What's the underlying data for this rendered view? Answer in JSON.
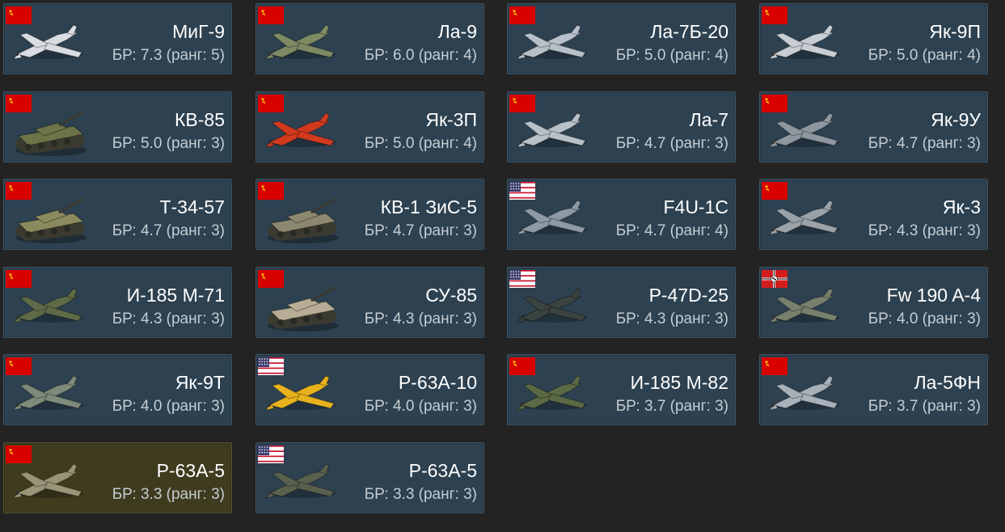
{
  "colors": {
    "background": "#232323",
    "card": "#2d4150",
    "card_premium": "#3f3b1f",
    "name_text": "#ffffff",
    "br_text": "#c5cdd3"
  },
  "vehicles": [
    {
      "name": "МиГ-9",
      "br": "БР: 7.3 (ранг: 5)",
      "nation": "ussr",
      "type": "plane",
      "color": "#d9dde2",
      "premium": false
    },
    {
      "name": "Ла-9",
      "br": "БР: 6.0 (ранг: 4)",
      "nation": "ussr",
      "type": "plane",
      "color": "#7d8a63",
      "premium": false
    },
    {
      "name": "Ла-7Б-20",
      "br": "БР: 5.0 (ранг: 4)",
      "nation": "ussr",
      "type": "plane",
      "color": "#b7c0c8",
      "premium": false
    },
    {
      "name": "Як-9П",
      "br": "БР: 5.0 (ранг: 4)",
      "nation": "ussr",
      "type": "plane",
      "color": "#c7cdd3",
      "premium": false
    },
    {
      "name": "КВ-85",
      "br": "БР: 5.0 (ранг: 3)",
      "nation": "ussr",
      "type": "tank",
      "color": "#6c7448",
      "premium": false
    },
    {
      "name": "Як-3П",
      "br": "БР: 5.0 (ранг: 4)",
      "nation": "ussr",
      "type": "plane",
      "color": "#d23a1e",
      "premium": false
    },
    {
      "name": "Ла-7",
      "br": "БР: 4.7 (ранг: 3)",
      "nation": "ussr",
      "type": "plane",
      "color": "#b9c1c8",
      "premium": false
    },
    {
      "name": "Як-9У",
      "br": "БР: 4.7 (ранг: 3)",
      "nation": "ussr",
      "type": "plane",
      "color": "#8e979f",
      "premium": false
    },
    {
      "name": "Т-34-57",
      "br": "БР: 4.7 (ранг: 3)",
      "nation": "ussr",
      "type": "tank",
      "color": "#8a8a5e",
      "premium": false
    },
    {
      "name": "КВ-1 ЗиС-5",
      "br": "БР: 4.7 (ранг: 3)",
      "nation": "ussr",
      "type": "tank",
      "color": "#8c8870",
      "premium": false
    },
    {
      "name": "F4U-1C",
      "br": "БР: 4.7 (ранг: 4)",
      "nation": "usa",
      "type": "plane",
      "color": "#8d9aa6",
      "premium": false
    },
    {
      "name": "Як-3",
      "br": "БР: 4.3 (ранг: 3)",
      "nation": "ussr",
      "type": "plane",
      "color": "#9aa2a8",
      "premium": false
    },
    {
      "name": "И-185 М-71",
      "br": "БР: 4.3 (ранг: 3)",
      "nation": "ussr",
      "type": "plane",
      "color": "#5f6b48",
      "premium": false
    },
    {
      "name": "СУ-85",
      "br": "БР: 4.3 (ранг: 3)",
      "nation": "ussr",
      "type": "tank",
      "color": "#b6ad94",
      "premium": false
    },
    {
      "name": "P-47D-25",
      "br": "БР: 4.3 (ранг: 3)",
      "nation": "usa",
      "type": "plane",
      "color": "#3b4340",
      "premium": false
    },
    {
      "name": "Fw 190 A-4",
      "br": "БР: 4.0 (ранг: 3)",
      "nation": "germany",
      "type": "plane",
      "color": "#77806c",
      "premium": false
    },
    {
      "name": "Як-9Т",
      "br": "БР: 4.0 (ранг: 3)",
      "nation": "ussr",
      "type": "plane",
      "color": "#7e8a7a",
      "premium": false
    },
    {
      "name": "P-63A-10",
      "br": "БР: 4.0 (ранг: 3)",
      "nation": "usa",
      "type": "plane",
      "color": "#e8b21e",
      "premium": false
    },
    {
      "name": "И-185 М-82",
      "br": "БР: 3.7 (ранг: 3)",
      "nation": "ussr",
      "type": "plane",
      "color": "#5b6945",
      "premium": false
    },
    {
      "name": "Ла-5ФН",
      "br": "БР: 3.7 (ранг: 3)",
      "nation": "ussr",
      "type": "plane",
      "color": "#a8b1ba",
      "premium": false
    },
    {
      "name": "P-63A-5",
      "br": "БР: 3.3 (ранг: 3)",
      "nation": "ussr",
      "type": "plane",
      "color": "#9a9478",
      "premium": true
    },
    {
      "name": "P-63A-5",
      "br": "БР: 3.3 (ранг: 3)",
      "nation": "usa",
      "type": "plane",
      "color": "#59604e",
      "premium": false
    }
  ]
}
